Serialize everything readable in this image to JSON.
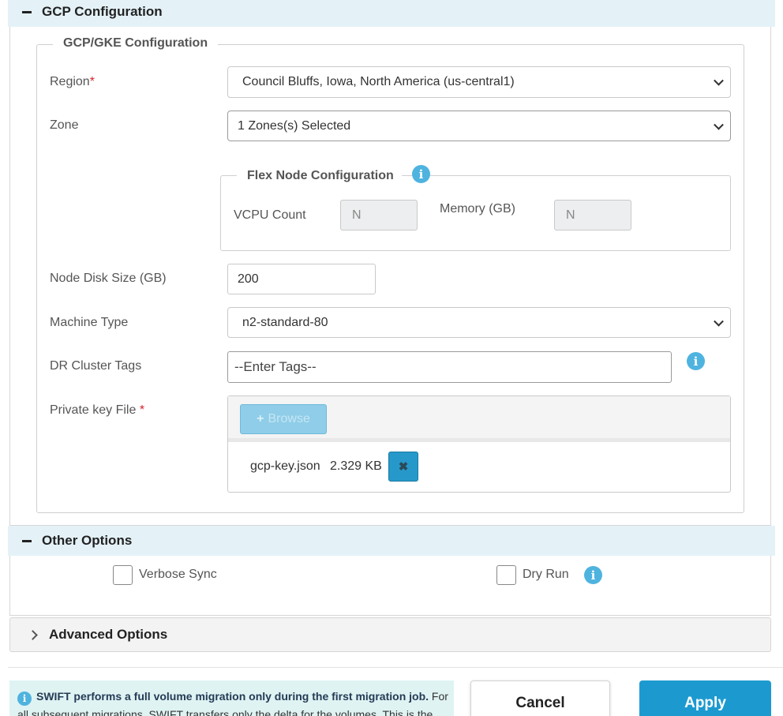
{
  "gcp_section": {
    "title": "GCP Configuration"
  },
  "gke_fieldset": {
    "legend": "GCP/GKE Configuration",
    "region": {
      "label": "Region",
      "required_mark": "*",
      "value": "Council Bluffs, Iowa, North America (us-central1)"
    },
    "zone": {
      "label": "Zone",
      "value": "1 Zones(s) Selected"
    },
    "flex_node": {
      "legend": "Flex Node Configuration",
      "vcpu": {
        "label": "VCPU Count",
        "value": "N"
      },
      "memory": {
        "label": "Memory (GB)",
        "value": "N"
      }
    },
    "node_disk": {
      "label": "Node Disk Size (GB)",
      "value": "200"
    },
    "machine_type": {
      "label": "Machine Type",
      "value": "n2-standard-80"
    },
    "dr_tags": {
      "label": "DR Cluster Tags",
      "placeholder": "--Enter Tags--"
    },
    "private_key": {
      "label": "Private key File",
      "required_mark": "*",
      "browse_label": "Browse",
      "file_name": "gcp-key.json",
      "file_size": "2.329 KB"
    }
  },
  "other_section": {
    "title": "Other Options",
    "verbose_sync": "Verbose Sync",
    "dry_run": "Dry Run"
  },
  "advanced_section": {
    "title": "Advanced Options"
  },
  "note": {
    "bold": "SWIFT performs a full volume migration only during the first migration job.",
    "rest": " For all subsequent migrations, SWIFT transfers only the delta for the volumes. This is the default"
  },
  "buttons": {
    "cancel": "Cancel",
    "apply": "Apply"
  },
  "colors": {
    "accent": "#1c9ad0",
    "info": "#4fb3df",
    "required": "#d9232e",
    "section_bg": "#e4f2f8"
  }
}
